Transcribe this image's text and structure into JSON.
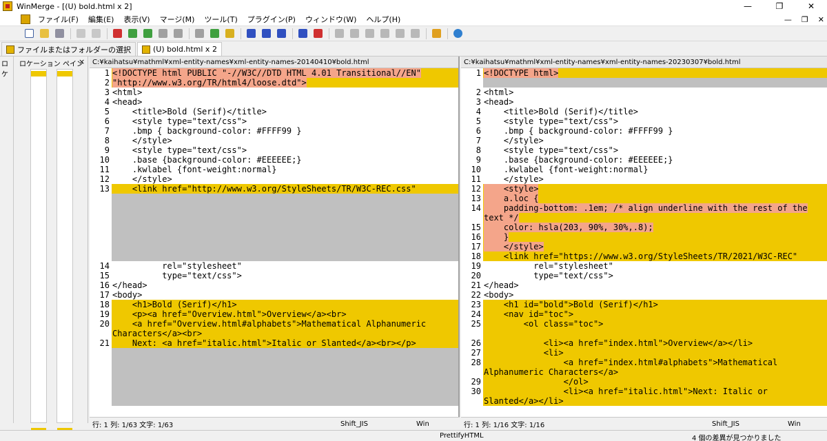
{
  "window": {
    "title": "WinMerge - [(U) bold.html x 2]",
    "controls": {
      "minimize": "—",
      "maximize": "❐",
      "close": "✕"
    }
  },
  "menu": {
    "items": [
      "ファイル(F)",
      "編集(E)",
      "表示(V)",
      "マージ(M)",
      "ツール(T)",
      "プラグイン(P)",
      "ウィンドウ(W)",
      "ヘルプ(H)"
    ],
    "mdi": {
      "minimize": "—",
      "restore": "❐",
      "close": "✕"
    }
  },
  "tabs": [
    {
      "label": "ファイルまたはフォルダーの選択",
      "active": false
    },
    {
      "label": "(U) bold.html x 2",
      "active": true
    }
  ],
  "location_pane": {
    "side_label": "ロケ",
    "title": "ロケーション ペイン",
    "close": "×"
  },
  "left_pane": {
    "path": "C:¥kaihatsu¥mathml¥xml-entity-names¥xml-entity-names-20140410¥bold.html",
    "status": {
      "position": "行: 1  列: 1/63  文字: 1/63",
      "encoding": "Shift_JIS",
      "eol": "Win"
    },
    "lines": [
      {
        "n": "1",
        "kind": "diff",
        "text": "<!DOCTYPE html PUBLIC \"-//W3C//DTD HTML 4.01 Transitional//EN\"",
        "hl": true
      },
      {
        "n": "2",
        "kind": "diff",
        "text": "\"http://www.w3.org/TR/html4/loose.dtd\">",
        "hl": true
      },
      {
        "n": "3",
        "kind": "same",
        "text": "<html>"
      },
      {
        "n": "4",
        "kind": "same",
        "text": "<head>"
      },
      {
        "n": "5",
        "kind": "same",
        "text": "    <title>Bold (Serif)</title>"
      },
      {
        "n": "6",
        "kind": "same",
        "text": "    <style type=\"text/css\">"
      },
      {
        "n": "7",
        "kind": "same",
        "text": "    .bmp { background-color: #FFFF99 }"
      },
      {
        "n": "8",
        "kind": "same",
        "text": "    </style>"
      },
      {
        "n": "9",
        "kind": "same",
        "text": "    <style type=\"text/css\">"
      },
      {
        "n": "10",
        "kind": "same",
        "text": "    .base {background-color: #EEEEEE;}"
      },
      {
        "n": "11",
        "kind": "same",
        "text": "    .kwlabel {font-weight:normal}"
      },
      {
        "n": "12",
        "kind": "same",
        "text": "    </style>"
      },
      {
        "n": "13",
        "kind": "diff",
        "text": "    <link href=\"http://www.w3.org/StyleSheets/TR/W3C-REC.css\""
      },
      {
        "n": "",
        "kind": "gap",
        "text": ""
      },
      {
        "n": "",
        "kind": "gap",
        "text": ""
      },
      {
        "n": "",
        "kind": "gap",
        "text": ""
      },
      {
        "n": "",
        "kind": "gap",
        "text": ""
      },
      {
        "n": "",
        "kind": "gap",
        "text": ""
      },
      {
        "n": "",
        "kind": "gap",
        "text": ""
      },
      {
        "n": "",
        "kind": "gap",
        "text": ""
      },
      {
        "n": "14",
        "kind": "same",
        "text": "          rel=\"stylesheet\""
      },
      {
        "n": "15",
        "kind": "same",
        "text": "          type=\"text/css\">"
      },
      {
        "n": "16",
        "kind": "same",
        "text": "</head>"
      },
      {
        "n": "17",
        "kind": "same",
        "text": "<body>"
      },
      {
        "n": "18",
        "kind": "diff",
        "text": "    <h1>Bold (Serif)</h1>"
      },
      {
        "n": "19",
        "kind": "diff",
        "text": "    <p><a href=\"Overview.html\">Overview</a><br>"
      },
      {
        "n": "20",
        "kind": "diff",
        "text": "    <a href=\"Overview.html#alphabets\">Mathematical Alphanumeric"
      },
      {
        "n": "",
        "kind": "diff",
        "text": "Characters</a><br>"
      },
      {
        "n": "21",
        "kind": "diff",
        "text": "    Next: <a href=\"italic.html\">Italic or Slanted</a><br></p>"
      },
      {
        "n": "",
        "kind": "gap",
        "text": ""
      },
      {
        "n": "",
        "kind": "gap",
        "text": ""
      },
      {
        "n": "",
        "kind": "gap",
        "text": ""
      },
      {
        "n": "",
        "kind": "gap",
        "text": ""
      },
      {
        "n": "",
        "kind": "gap",
        "text": ""
      },
      {
        "n": "",
        "kind": "gap",
        "text": ""
      }
    ]
  },
  "right_pane": {
    "path": "C:¥kaihatsu¥mathml¥xml-entity-names¥xml-entity-names-20230307¥bold.html",
    "status": {
      "position": "行: 1  列: 1/16  文字: 1/16",
      "encoding": "Shift_JIS",
      "eol": "Win"
    },
    "lines": [
      {
        "n": "1",
        "kind": "diff",
        "text": "<!DOCTYPE html>",
        "hl": true
      },
      {
        "n": "",
        "kind": "gap",
        "text": ""
      },
      {
        "n": "2",
        "kind": "same",
        "text": "<html>"
      },
      {
        "n": "3",
        "kind": "same",
        "text": "<head>"
      },
      {
        "n": "4",
        "kind": "same",
        "text": "    <title>Bold (Serif)</title>"
      },
      {
        "n": "5",
        "kind": "same",
        "text": "    <style type=\"text/css\">"
      },
      {
        "n": "6",
        "kind": "same",
        "text": "    .bmp { background-color: #FFFF99 }"
      },
      {
        "n": "7",
        "kind": "same",
        "text": "    </style>"
      },
      {
        "n": "8",
        "kind": "same",
        "text": "    <style type=\"text/css\">"
      },
      {
        "n": "9",
        "kind": "same",
        "text": "    .base {background-color: #EEEEEE;}"
      },
      {
        "n": "10",
        "kind": "same",
        "text": "    .kwlabel {font-weight:normal}"
      },
      {
        "n": "11",
        "kind": "same",
        "text": "    </style>"
      },
      {
        "n": "12",
        "kind": "diff",
        "text": "    <style>",
        "hl": true
      },
      {
        "n": "13",
        "kind": "diff",
        "text": "    a.loc {",
        "hl": true
      },
      {
        "n": "14",
        "kind": "diff",
        "text": "    padding-bottom: .1em; /* align underline with the rest of the",
        "hl": true
      },
      {
        "n": "",
        "kind": "diff",
        "text": "text */",
        "hl": true
      },
      {
        "n": "15",
        "kind": "diff",
        "text": "    color: hsla(203, 90%, 30%,.8);",
        "hl": true
      },
      {
        "n": "16",
        "kind": "diff",
        "text": "    }",
        "hl": true
      },
      {
        "n": "17",
        "kind": "diff",
        "text": "    </style>",
        "hl": true
      },
      {
        "n": "18",
        "kind": "diff",
        "text": "    <link href=\"https://www.w3.org/StyleSheets/TR/2021/W3C-REC\""
      },
      {
        "n": "19",
        "kind": "same",
        "text": "          rel=\"stylesheet\""
      },
      {
        "n": "20",
        "kind": "same",
        "text": "          type=\"text/css\">"
      },
      {
        "n": "21",
        "kind": "same",
        "text": "</head>"
      },
      {
        "n": "22",
        "kind": "same",
        "text": "<body>"
      },
      {
        "n": "23",
        "kind": "diff",
        "text": "    <h1 id=\"bold\">Bold (Serif)</h1>"
      },
      {
        "n": "24",
        "kind": "diff",
        "text": "    <nav id=\"toc\">"
      },
      {
        "n": "25",
        "kind": "diff",
        "text": "        <ol class=\"toc\">"
      },
      {
        "n": "",
        "kind": "diff",
        "text": ""
      },
      {
        "n": "26",
        "kind": "diff",
        "text": "            <li><a href=\"index.html\">Overview</a></li>"
      },
      {
        "n": "27",
        "kind": "diff",
        "text": "            <li>"
      },
      {
        "n": "28",
        "kind": "diff",
        "text": "                <a href=\"index.html#alphabets\">Mathematical"
      },
      {
        "n": "",
        "kind": "diff",
        "text": "Alphanumeric Characters</a>"
      },
      {
        "n": "29",
        "kind": "diff",
        "text": "                </ol>"
      },
      {
        "n": "30",
        "kind": "diff",
        "text": "                <li><a href=\"italic.html\">Next: Italic or"
      },
      {
        "n": "",
        "kind": "diff",
        "text": "Slanted</a></li>"
      }
    ]
  },
  "statusbar": {
    "plugin": "PrettifyHTML",
    "diffs": "4 個の差異が見つかりました"
  },
  "colors": {
    "diff": "#efc800",
    "diff_highlight": "#f4a58a",
    "gap": "#c0c0c0"
  }
}
